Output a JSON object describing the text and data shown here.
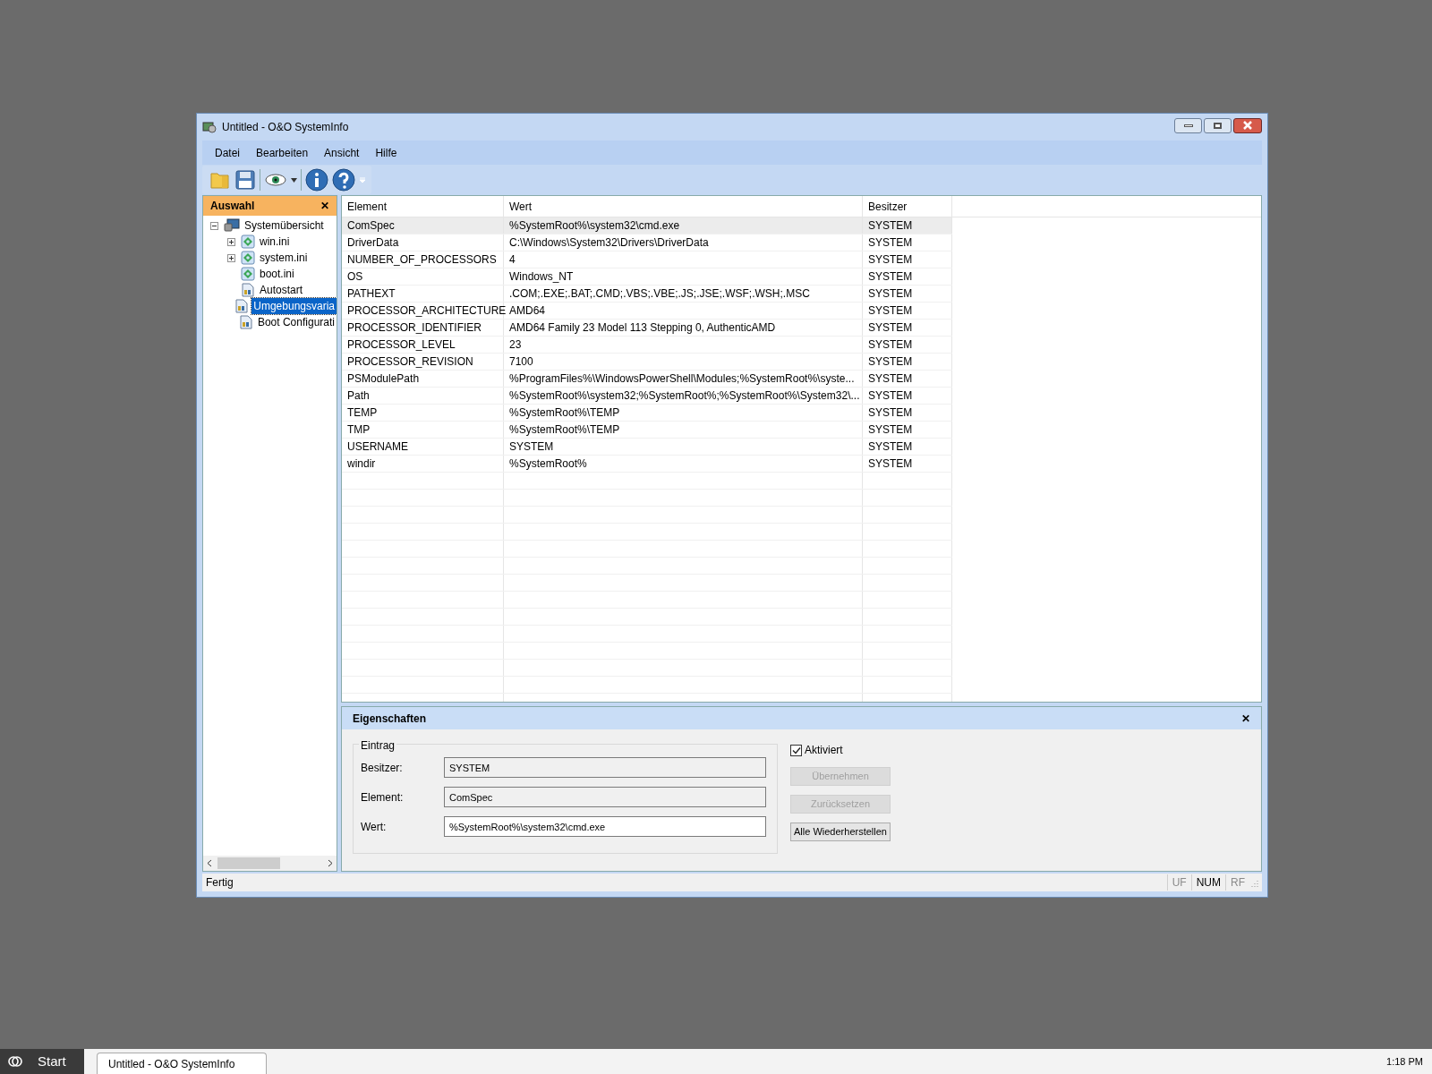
{
  "window": {
    "title": "Untitled - O&O SystemInfo"
  },
  "menu": [
    "Datei",
    "Bearbeiten",
    "Ansicht",
    "Hilfe"
  ],
  "sidebar": {
    "title": "Auswahl",
    "close": "✕",
    "tree": [
      {
        "label": "Systemübersicht",
        "kind": "computer",
        "expanded": true,
        "selected": false,
        "children": [
          {
            "label": "win.ini",
            "kind": "ini",
            "expanded": false,
            "selected": false
          },
          {
            "label": "system.ini",
            "kind": "ini",
            "expanded": false,
            "selected": false
          },
          {
            "label": "boot.ini",
            "kind": "ini",
            "selected": false
          },
          {
            "label": "Autostart",
            "kind": "doc",
            "selected": false
          },
          {
            "label": "Umgebungsvaria",
            "kind": "doc",
            "selected": true
          },
          {
            "label": "Boot Configurati",
            "kind": "doc",
            "selected": false
          }
        ]
      }
    ]
  },
  "table": {
    "columns": [
      "Element",
      "Wert",
      "Besitzer"
    ],
    "rows": [
      {
        "cells": [
          "ComSpec",
          "%SystemRoot%\\system32\\cmd.exe",
          "SYSTEM"
        ],
        "selected": true
      },
      {
        "cells": [
          "DriverData",
          "C:\\Windows\\System32\\Drivers\\DriverData",
          "SYSTEM"
        ],
        "selected": false
      },
      {
        "cells": [
          "NUMBER_OF_PROCESSORS",
          "4",
          "SYSTEM"
        ],
        "selected": false
      },
      {
        "cells": [
          "OS",
          "Windows_NT",
          "SYSTEM"
        ],
        "selected": false
      },
      {
        "cells": [
          "PATHEXT",
          ".COM;.EXE;.BAT;.CMD;.VBS;.VBE;.JS;.JSE;.WSF;.WSH;.MSC",
          "SYSTEM"
        ],
        "selected": false
      },
      {
        "cells": [
          "PROCESSOR_ARCHITECTURE",
          "AMD64",
          "SYSTEM"
        ],
        "selected": false
      },
      {
        "cells": [
          "PROCESSOR_IDENTIFIER",
          "AMD64 Family 23 Model 113 Stepping 0, AuthenticAMD",
          "SYSTEM"
        ],
        "selected": false
      },
      {
        "cells": [
          "PROCESSOR_LEVEL",
          "23",
          "SYSTEM"
        ],
        "selected": false
      },
      {
        "cells": [
          "PROCESSOR_REVISION",
          "7100",
          "SYSTEM"
        ],
        "selected": false
      },
      {
        "cells": [
          "PSModulePath",
          "%ProgramFiles%\\WindowsPowerShell\\Modules;%SystemRoot%\\syste...",
          "SYSTEM"
        ],
        "selected": false
      },
      {
        "cells": [
          "Path",
          "%SystemRoot%\\system32;%SystemRoot%;%SystemRoot%\\System32\\...",
          "SYSTEM"
        ],
        "selected": false
      },
      {
        "cells": [
          "TEMP",
          "%SystemRoot%\\TEMP",
          "SYSTEM"
        ],
        "selected": false
      },
      {
        "cells": [
          "TMP",
          "%SystemRoot%\\TEMP",
          "SYSTEM"
        ],
        "selected": false
      },
      {
        "cells": [
          "USERNAME",
          "SYSTEM",
          "SYSTEM"
        ],
        "selected": false
      },
      {
        "cells": [
          "windir",
          "%SystemRoot%",
          "SYSTEM"
        ],
        "selected": false
      }
    ]
  },
  "properties": {
    "title": "Eigenschaften",
    "close": "✕",
    "group": "Eintrag",
    "fields": [
      {
        "label": "Besitzer:",
        "value": "SYSTEM",
        "readonly": true
      },
      {
        "label": "Element:",
        "value": "ComSpec",
        "readonly": true
      },
      {
        "label": "Wert:",
        "value": "%SystemRoot%\\system32\\cmd.exe",
        "readonly": false
      }
    ],
    "checkbox": {
      "label": "Aktiviert",
      "checked": true
    },
    "buttons": [
      {
        "label": "Übernehmen",
        "disabled": true
      },
      {
        "label": "Zurücksetzen",
        "disabled": true
      },
      {
        "label": "Alle Wiederherstellen",
        "disabled": false
      }
    ]
  },
  "status_bar": {
    "text": "Fertig",
    "indicators": [
      {
        "label": "UF",
        "active": false
      },
      {
        "label": "NUM",
        "active": true
      },
      {
        "label": "RF",
        "active": false
      }
    ]
  },
  "taskbar": {
    "start": "Start",
    "tasks": [
      {
        "label": "Untitled - O&O SystemInfo",
        "selected": true
      }
    ],
    "clock": "1:18 PM"
  }
}
